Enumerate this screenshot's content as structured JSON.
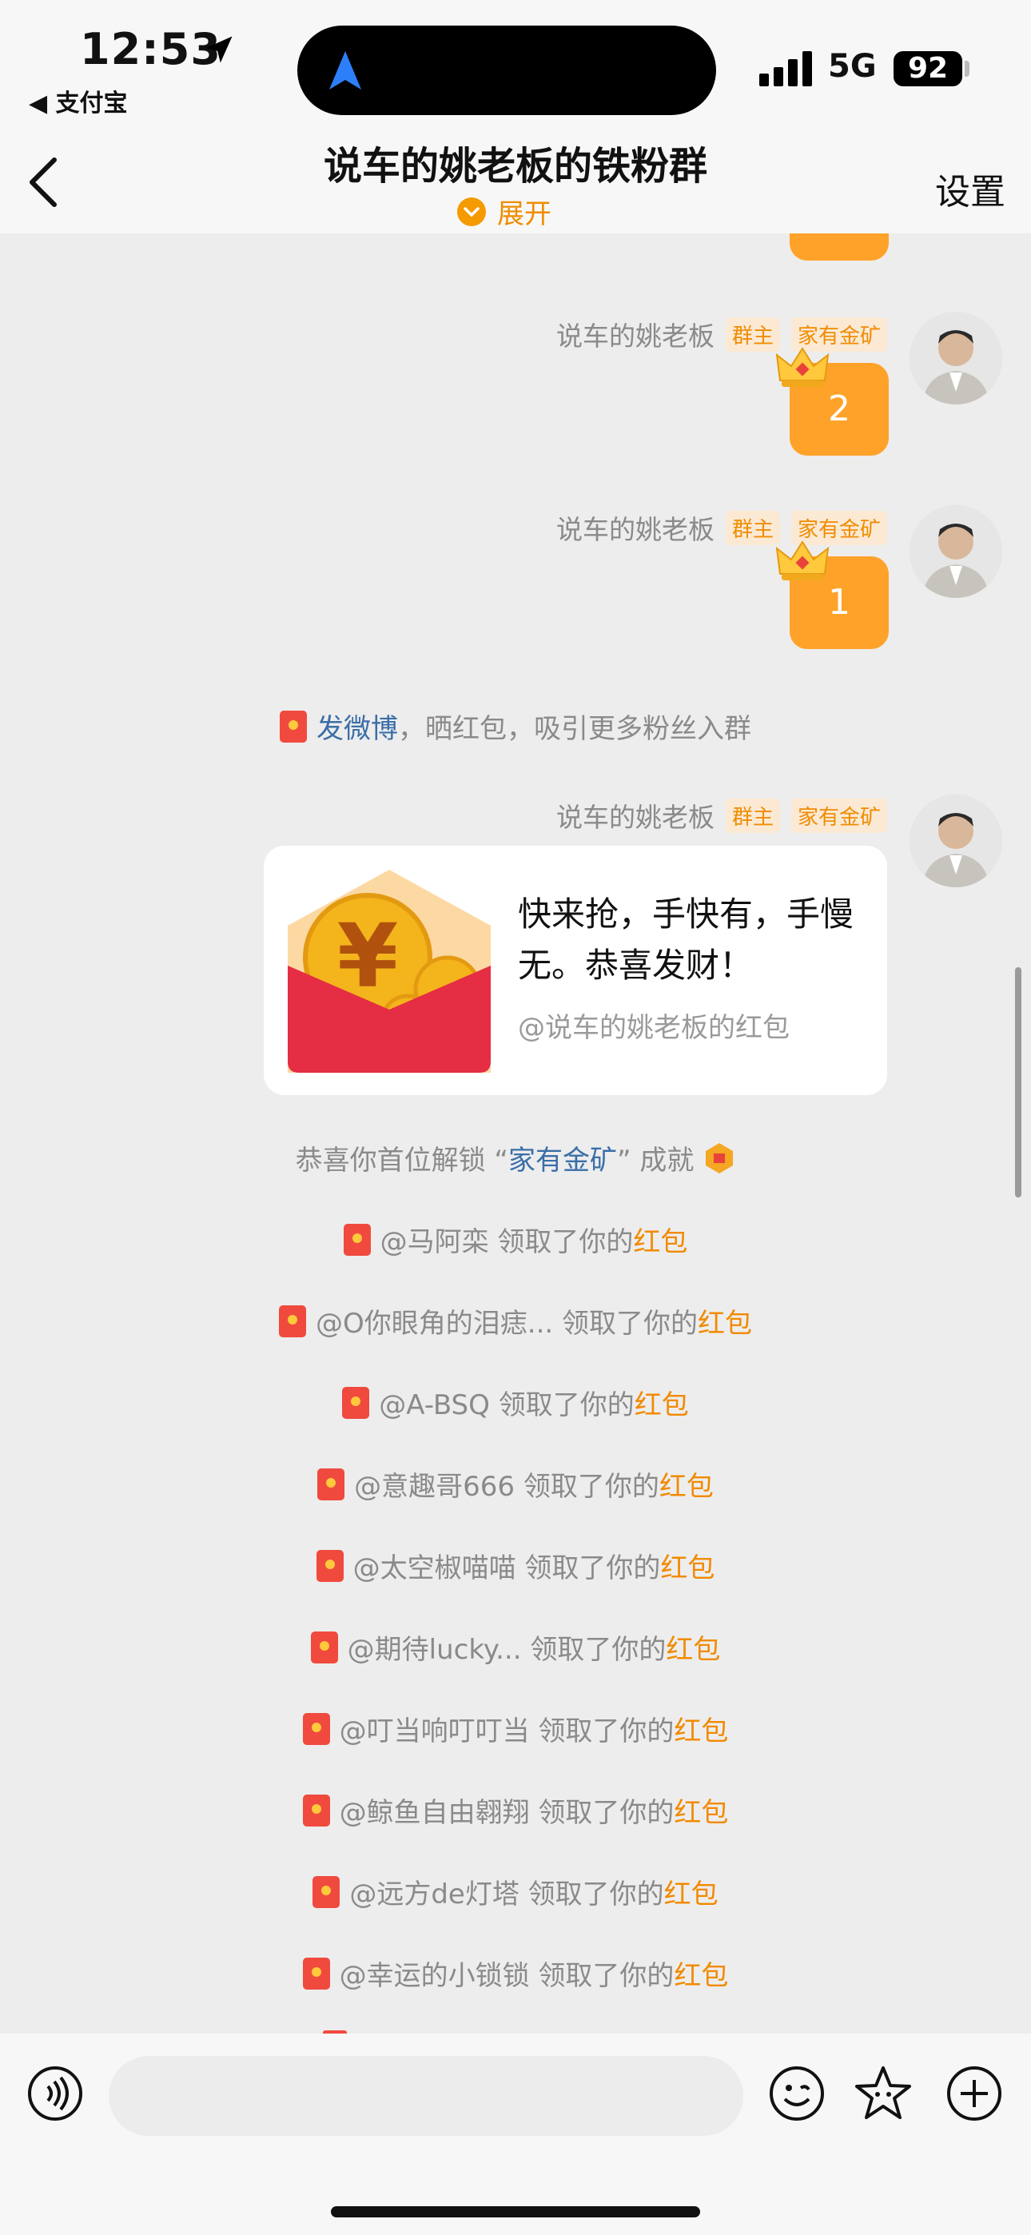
{
  "status_bar": {
    "time": "12:53",
    "back_app": "◀ 支付宝",
    "network": "5G",
    "battery": "92"
  },
  "header": {
    "title": "说车的姚老板的铁粉群",
    "expand_label": "展开",
    "settings_label": "设置"
  },
  "messages": [
    {
      "sender": "说车的姚老板",
      "tags": [
        "群主",
        "家有金矿"
      ],
      "text": "2"
    },
    {
      "sender": "说车的姚老板",
      "tags": [
        "群主",
        "家有金矿"
      ],
      "text": "1"
    }
  ],
  "promo": {
    "link": "发微博",
    "rest": "，晒红包，吸引更多粉丝入群"
  },
  "red_packet_msg": {
    "sender": "说车的姚老板",
    "tags": [
      "群主",
      "家有金矿"
    ],
    "text": "快来抢，手快有，手慢无。恭喜发财！",
    "sub": "@说车的姚老板的红包"
  },
  "achievement": {
    "prefix": "恭喜你首位解锁 “",
    "name": "家有金矿",
    "suffix": "” 成就"
  },
  "claims": [
    {
      "user": "@马阿栾",
      "action": " 领取了你的",
      "item": "红包"
    },
    {
      "user": "@O你眼角的泪痣...",
      "action": " 领取了你的",
      "item": "红包"
    },
    {
      "user": "@A-BSQ",
      "action": " 领取了你的",
      "item": "红包"
    },
    {
      "user": "@意趣哥666",
      "action": " 领取了你的",
      "item": "红包"
    },
    {
      "user": "@太空椒喵喵",
      "action": " 领取了你的",
      "item": "红包"
    },
    {
      "user": "@期待lucky...",
      "action": " 领取了你的",
      "item": "红包"
    },
    {
      "user": "@叮当响叮叮当",
      "action": " 领取了你的",
      "item": "红包"
    },
    {
      "user": "@鲸鱼自由翱翔",
      "action": " 领取了你的",
      "item": "红包"
    },
    {
      "user": "@远方de灯塔",
      "action": " 领取了你的",
      "item": "红包"
    },
    {
      "user": "@幸运的小锁锁",
      "action": " 领取了你的",
      "item": "红包"
    }
  ],
  "icons": {
    "voice": "voice-icon",
    "emoji": "emoji-icon",
    "sticker": "sticker-icon",
    "plus": "plus-icon"
  },
  "colors": {
    "accent": "#f59a00",
    "bubble": "#ffa229",
    "link": "#3b6ea8",
    "envelope": "#f04a3e"
  }
}
